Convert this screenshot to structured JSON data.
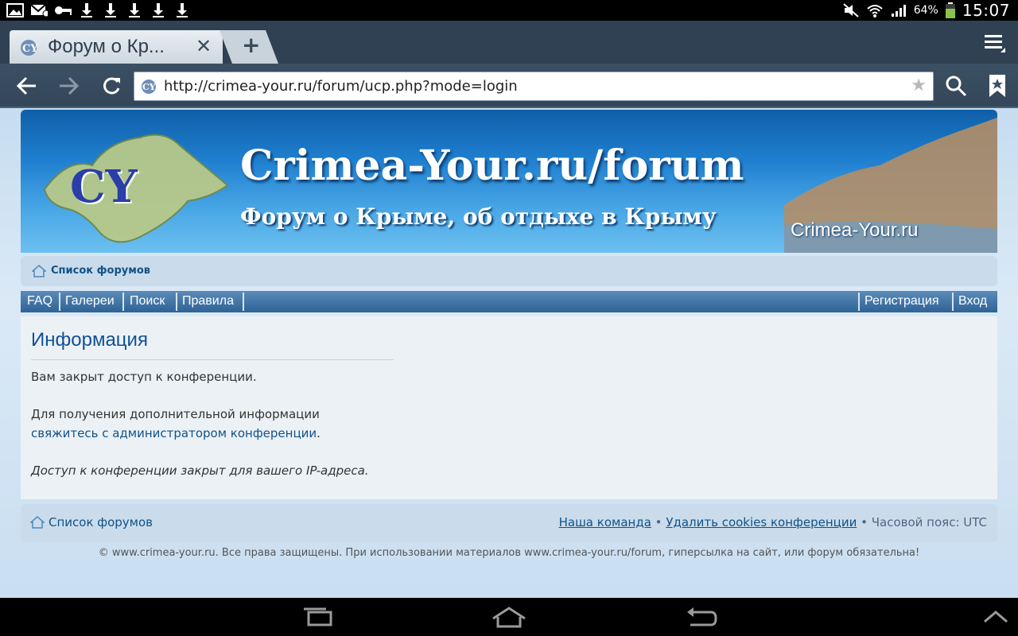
{
  "status_bar": {
    "battery": "64%",
    "time": "15:07",
    "icons": [
      "gallery-icon",
      "mail-icon",
      "key-icon",
      "download-icon",
      "download-icon",
      "download-icon",
      "download-icon",
      "download-icon",
      "mute-icon",
      "wifi-icon",
      "signal-icon",
      "battery-icon"
    ]
  },
  "browser": {
    "tab_title": "Форум о Кр...",
    "url": "http://crimea-your.ru/forum/ucp.php?mode=login",
    "buttons": [
      "back-icon",
      "forward-icon",
      "refresh-icon",
      "search-icon",
      "bookmark-icon",
      "menu-icon"
    ]
  },
  "banner": {
    "title": "Crimea-Your.ru/forum",
    "subtitle": "Форум о Крыме, об отдыхе в Крыму",
    "brand": "Crimea-Your.ru",
    "logo_text": "CY"
  },
  "breadcrumb": {
    "home_label": "Список форумов"
  },
  "nav": {
    "left": [
      "FAQ",
      "Галереи",
      "Поиск",
      "Правила"
    ],
    "right": [
      "Регистрация",
      "Вход"
    ]
  },
  "info": {
    "heading": "Информация",
    "line1": "Вам закрыт доступ к конференции.",
    "line2": "Для получения дополнительной информации",
    "contact_link": "свяжитесь с администратором конференции",
    "contact_suffix": ".",
    "line3": "Доступ к конференции закрыт для вашего IP-адреса."
  },
  "footer": {
    "home_label": "Список форумов",
    "team": "Наша команда",
    "delete_cookies": "Удалить cookies конференции",
    "timezone": "Часовой пояс: UTC",
    "bullet": "•"
  },
  "copyright": "© www.crimea-your.ru. Все права защищены. При использовании материалов www.crimea-your.ru/forum, гиперсылка на сайт, или форум обязательна!",
  "colors": {
    "link": "#105289",
    "heading": "#115098",
    "nav_bar": "#2f6396",
    "panel_bg": "#ecf1f5"
  }
}
